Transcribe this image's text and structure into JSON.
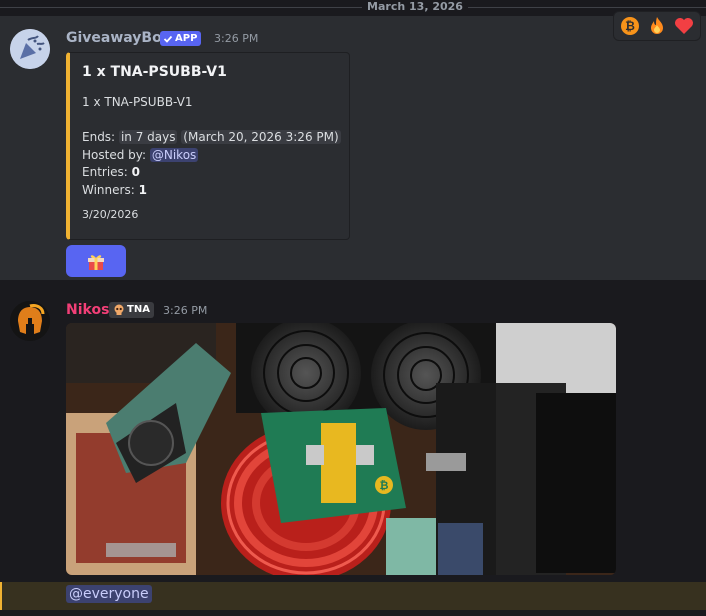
{
  "date_divider": "March 13, 2026",
  "reactions": [
    {
      "name": "bitcoin",
      "color": "#f7931a"
    },
    {
      "name": "fire",
      "color": "#ff8a1c"
    },
    {
      "name": "heart",
      "color": "#f23f43"
    }
  ],
  "message1": {
    "author": "GiveawayBot",
    "tag": "APP",
    "time": "3:26 PM",
    "embed": {
      "title": "1 x TNA-PSUBB-V1",
      "description": "1 x TNA-PSUBB-V1",
      "ends_label": "Ends:",
      "ends_relative": "in 7 days",
      "ends_absolute": "March 20, 2026 3:26 PM",
      "hosted_label": "Hosted by:",
      "host": "@Nikos",
      "entries_label": "Entries:",
      "entries": "0",
      "winners_label": "Winners:",
      "winners": "1",
      "footer": "3/20/2026",
      "accent_color": "#f0b232"
    },
    "button": {
      "icon": "gift-icon"
    }
  },
  "message2": {
    "author": "Nikos",
    "role": "TNA",
    "time": "3:26 PM",
    "attachment": {
      "icon": "photo"
    },
    "mention": "@everyone"
  }
}
